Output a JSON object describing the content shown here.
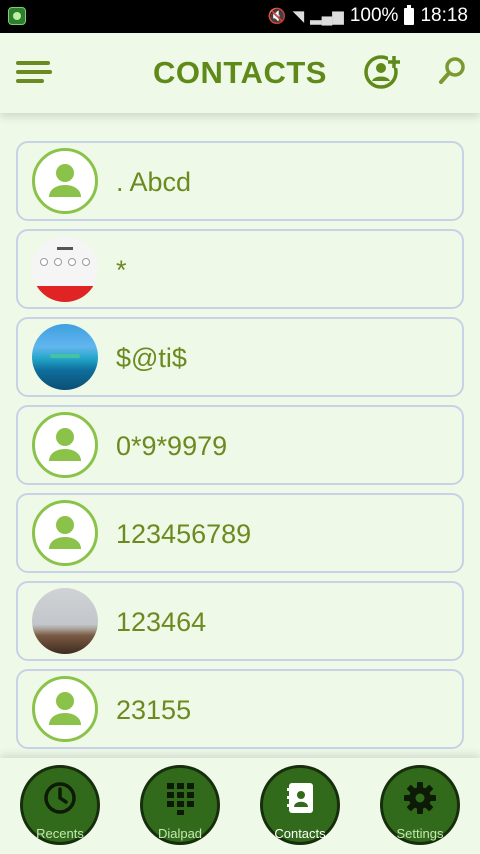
{
  "status_bar": {
    "battery": "100%",
    "time": "18:18",
    "icons": [
      "mute-icon",
      "wifi-icon",
      "signal-icon",
      "battery-icon"
    ]
  },
  "header": {
    "title": "CONTACTS"
  },
  "contacts": [
    {
      "name": ". Abcd",
      "avatar": "default"
    },
    {
      "name": "*",
      "avatar": "calling-screenshot"
    },
    {
      "name": "$@ti$",
      "avatar": "ocean-photo"
    },
    {
      "name": "0*9*9979",
      "avatar": "default"
    },
    {
      "name": "123456789",
      "avatar": "default"
    },
    {
      "name": "123464",
      "avatar": "room-photo"
    },
    {
      "name": "23155",
      "avatar": "default"
    }
  ],
  "nav": [
    {
      "label": "Recents",
      "icon": "clock-icon"
    },
    {
      "label": "Dialpad",
      "icon": "dialpad-icon"
    },
    {
      "label": "Contacts",
      "icon": "contacts-book-icon",
      "active": true
    },
    {
      "label": "Settings",
      "icon": "gear-icon"
    }
  ],
  "colors": {
    "accent": "#5f8a1a",
    "background": "#eef9e8",
    "nav_button": "#326a1b",
    "avatar_ring": "#8bc34a"
  }
}
